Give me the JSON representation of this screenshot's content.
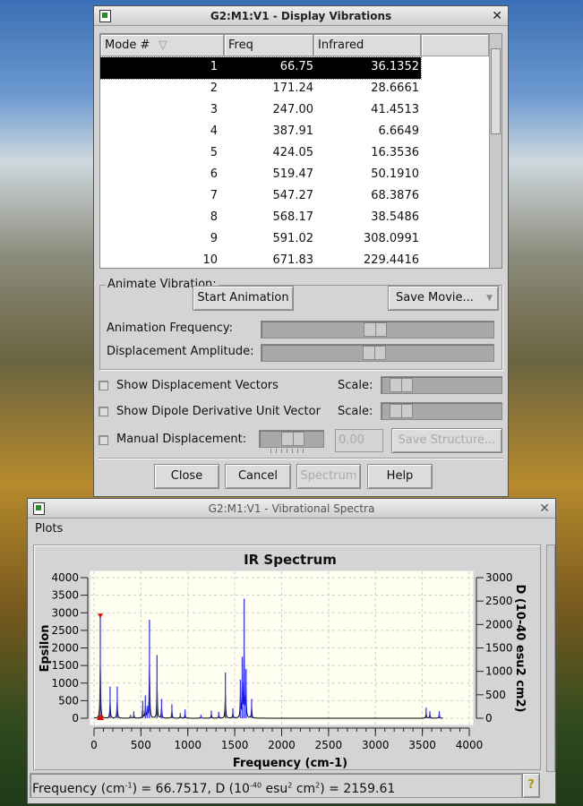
{
  "vib_window": {
    "title": "G2:M1:V1 - Display Vibrations",
    "columns": [
      "Mode #",
      "Freq",
      "Infrared",
      ""
    ],
    "rows": [
      {
        "mode": "1",
        "freq": "66.75",
        "ir": "36.1352"
      },
      {
        "mode": "2",
        "freq": "171.24",
        "ir": "28.6661"
      },
      {
        "mode": "3",
        "freq": "247.00",
        "ir": "41.4513"
      },
      {
        "mode": "4",
        "freq": "387.91",
        "ir": "6.6649"
      },
      {
        "mode": "5",
        "freq": "424.05",
        "ir": "16.3536"
      },
      {
        "mode": "6",
        "freq": "519.47",
        "ir": "50.1910"
      },
      {
        "mode": "7",
        "freq": "547.27",
        "ir": "68.3876"
      },
      {
        "mode": "8",
        "freq": "568.17",
        "ir": "38.5486"
      },
      {
        "mode": "9",
        "freq": "591.02",
        "ir": "308.0991"
      },
      {
        "mode": "10",
        "freq": "671.83",
        "ir": "229.4416"
      }
    ],
    "selected_row": 0,
    "animate_group": "Animate Vibration:",
    "start_animation": "Start Animation",
    "save_movie": "Save Movie...",
    "anim_freq_label": "Animation Frequency:",
    "disp_amp_label": "Displacement Amplitude:",
    "anim_freq_value": 0.5,
    "disp_amp_value": 0.5,
    "show_disp_vectors": "Show Displacement Vectors",
    "show_dipole": "Show Dipole Derivative Unit Vector",
    "scale_label": "Scale:",
    "manual_disp": "Manual Displacement:",
    "manual_value": "0.00",
    "save_structure": "Save Structure...",
    "close": "Close",
    "cancel": "Cancel",
    "spectrum": "Spectrum",
    "help": "Help"
  },
  "spectra_window": {
    "title": "G2:M1:V1 - Vibrational Spectra",
    "menu_plots": "Plots",
    "status": "Frequency (cm-1) = 66.7517, D (10-40 esu2 cm2) = 2159.61",
    "help_icon": "question-mark-icon"
  },
  "chart_data": {
    "type": "line",
    "title": "IR Spectrum",
    "xlabel": "Frequency (cm-1)",
    "ylabel": "Epsilon",
    "y2label": "D (10-40 esu2 cm2)",
    "xlim": [
      0,
      4000
    ],
    "ylim": [
      0,
      4000
    ],
    "y2lim": [
      0,
      3000
    ],
    "xticks": [
      "0",
      "500",
      "1000",
      "1500",
      "2000",
      "2500",
      "3000",
      "3500",
      "4000"
    ],
    "yticks": [
      "0",
      "500",
      "1000",
      "1500",
      "2000",
      "2500",
      "3000",
      "3500",
      "4000"
    ],
    "y2ticks": [
      "0",
      "500",
      "1000",
      "1500",
      "2000",
      "2500",
      "3000"
    ],
    "grid": true,
    "sticks_freq": [
      66.75,
      171.24,
      247,
      387.91,
      424.05,
      519.47,
      547.27,
      568.17,
      591.02,
      671.83,
      720,
      830,
      920,
      970,
      1140,
      1250,
      1330,
      1400,
      1480,
      1560,
      1580,
      1600,
      1620,
      1680,
      3540,
      3580,
      3680
    ],
    "sticks_epsilon": [
      2900,
      900,
      900,
      100,
      200,
      500,
      650,
      350,
      2800,
      1800,
      550,
      400,
      150,
      250,
      100,
      220,
      180,
      1300,
      280,
      1100,
      1750,
      3400,
      1400,
      550,
      300,
      200,
      200
    ],
    "selected_marker_freq": 66.75
  }
}
